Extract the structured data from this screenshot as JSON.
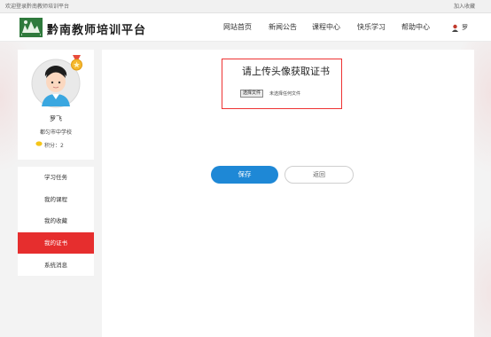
{
  "topbar": {
    "welcome": "欢迎登录黔南教师培训平台",
    "favorite": "加入收藏"
  },
  "header": {
    "logo_text": "黔南教师培训平台",
    "nav": [
      "网站首页",
      "新闻公告",
      "课程中心",
      "快乐学习",
      "帮助中心"
    ],
    "user_name": "罗"
  },
  "profile": {
    "name": "罗飞",
    "school": "都匀市中学校",
    "score_label": "积分：2"
  },
  "menu": {
    "items": [
      "学习任务",
      "我的课程",
      "我的收藏",
      "我的证书",
      "系统消息"
    ],
    "active_index": 3
  },
  "main": {
    "title": "请上传头像获取证书",
    "file_button": "选择文件",
    "file_status": "未选择任何文件",
    "save_label": "保存",
    "back_label": "返回"
  },
  "colors": {
    "accent_red": "#e62e2e",
    "primary_blue": "#1e88d6",
    "highlight_border": "#e33333"
  }
}
